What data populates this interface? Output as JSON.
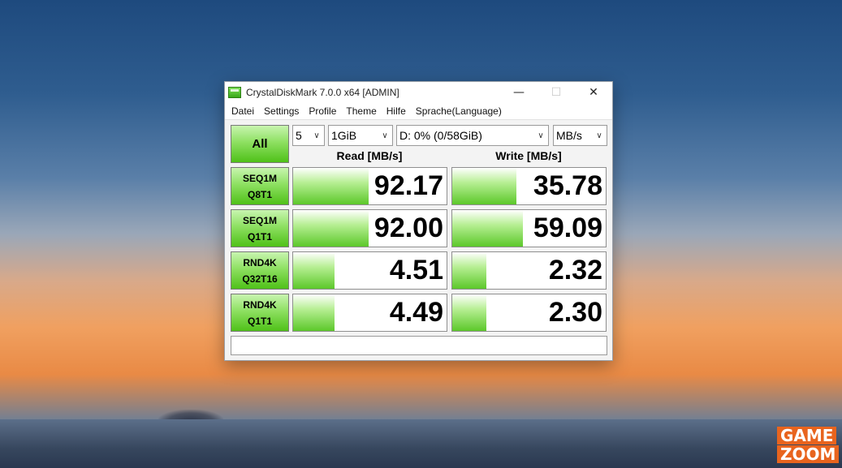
{
  "window": {
    "title": "CrystalDiskMark 7.0.0 x64 [ADMIN]",
    "minimize_glyph": "—",
    "maximize_glyph": "☐",
    "close_glyph": "✕"
  },
  "menu": [
    "Datei",
    "Settings",
    "Profile",
    "Theme",
    "Hilfe",
    "Sprache(Language)"
  ],
  "controls": {
    "all_label": "All",
    "count": "5",
    "size": "1GiB",
    "drive": "D: 0% (0/58GiB)",
    "unit": "MB/s"
  },
  "headers": {
    "read": "Read [MB/s]",
    "write": "Write [MB/s]"
  },
  "tests": [
    {
      "line1": "SEQ1M",
      "line2": "Q8T1",
      "read": "92.17",
      "write": "35.78",
      "read_fill": 0.49,
      "write_fill": 0.42
    },
    {
      "line1": "SEQ1M",
      "line2": "Q1T1",
      "read": "92.00",
      "write": "59.09",
      "read_fill": 0.49,
      "write_fill": 0.46
    },
    {
      "line1": "RND4K",
      "line2": "Q32T16",
      "read": "4.51",
      "write": "2.32",
      "read_fill": 0.27,
      "write_fill": 0.22
    },
    {
      "line1": "RND4K",
      "line2": "Q1T1",
      "read": "4.49",
      "write": "2.30",
      "read_fill": 0.27,
      "write_fill": 0.22
    }
  ],
  "comment": "",
  "watermark": {
    "line1": "GAME",
    "line2": "ZOOM",
    "color": "#e8641e"
  }
}
